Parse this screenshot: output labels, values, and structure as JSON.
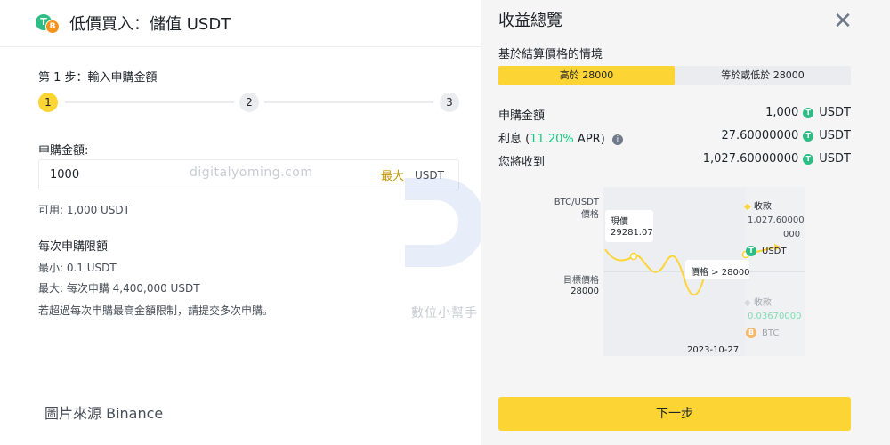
{
  "left": {
    "title": "低價買入：儲值 USDT",
    "step_title": "第 1 步：輸入申購金額",
    "steps": [
      "1",
      "2",
      "3"
    ],
    "amount_label": "申購金額:",
    "amount_value": "1000",
    "max_label": "最大",
    "unit": "USDT",
    "available": "可用: 1,000 USDT",
    "limit_title": "每次申購限額",
    "min": "最小: 0.1 USDT",
    "max": "最大: 每次申購 4,400,000 USDT",
    "note": "若超過每次申購最高金額限制，請提交多次申購。",
    "watermark": "digitalyoming.com",
    "watermark2": "數位小幫手",
    "source": "圖片來源 Binance"
  },
  "right": {
    "title": "收益總覽",
    "scenario_label": "基於結算價格的情境",
    "tabs": [
      {
        "label": "高於 28000",
        "active": true
      },
      {
        "label": "等於或低於 28000",
        "active": false
      }
    ],
    "rows": [
      {
        "label": "申購金額",
        "value": "1,000",
        "unit": "USDT"
      },
      {
        "label_prefix": "利息 (",
        "label_rate": "11.20%",
        "label_suffix": " APR)",
        "value": "27.60000000",
        "unit": "USDT"
      },
      {
        "label": "您將收到",
        "value": "1,027.60000000",
        "unit": "USDT"
      }
    ],
    "next_button": "下一步"
  },
  "chart": {
    "y_label_top": "BTC/USDT\n價格",
    "y_label_target": "目標價格",
    "target_value": "28000",
    "current_label": "現價",
    "current_value": "29281.07",
    "price_tag": "價格 > 28000",
    "receive_label": "收款",
    "receive_value_1": "1,027.60000",
    "receive_value_2": "000",
    "receive_unit": "USDT",
    "receive_label_2": "收款",
    "receive_btc_value": "0.03670000",
    "receive_btc_unit": "BTC",
    "date": "2023-10-27",
    "accent": "#fcd535",
    "green": "#0ecb81"
  }
}
